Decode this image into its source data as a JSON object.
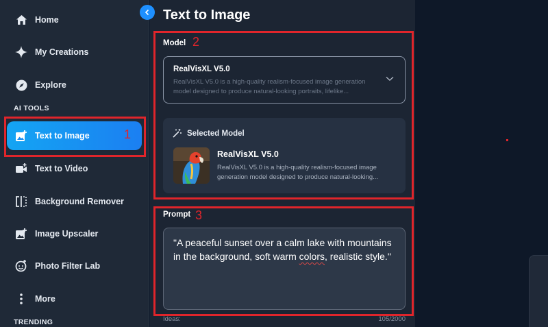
{
  "sidebar": {
    "items": [
      {
        "label": "Home",
        "icon": "home-icon"
      },
      {
        "label": "My Creations",
        "icon": "sparkle-icon"
      },
      {
        "label": "Explore",
        "icon": "compass-icon"
      }
    ],
    "section_ai_tools": "AI TOOLS",
    "tools": [
      {
        "label": "Text to Image",
        "icon": "image-plus-icon",
        "active": true
      },
      {
        "label": "Text to Video",
        "icon": "video-plus-icon"
      },
      {
        "label": "Background Remover",
        "icon": "bg-remove-icon"
      },
      {
        "label": "Image Upscaler",
        "icon": "image-upscale-icon"
      },
      {
        "label": "Photo Filter Lab",
        "icon": "face-filter-icon"
      },
      {
        "label": "More",
        "icon": "more-vertical-icon"
      }
    ],
    "section_trending": "TRENDING",
    "active_color": "#1b8ff2"
  },
  "main": {
    "title": "Text to Image",
    "model": {
      "label": "Model",
      "selected_name": "RealVisXL V5.0",
      "selected_desc": "RealVisXL V5.0 is a high-quality realism-focused image generation model designed to produce natural-looking portraits, lifelike..."
    },
    "selected_model": {
      "header": "Selected Model",
      "name": "RealVisXL V5.0",
      "desc": "RealVisXL V5.0 is a high-quality realism-focused image generation model designed to produce natural-looking..."
    },
    "prompt": {
      "label": "Prompt",
      "text_before": "\"A peaceful sunset over a calm lake with mountains in the background, soft warm ",
      "text_misspelled": "colors",
      "text_after": ", realistic style.\"",
      "ideas_label": "Ideas:",
      "counter": "105/2000"
    }
  },
  "annotations": {
    "numbers": [
      "1",
      "2",
      "3"
    ],
    "color": "#e0252b"
  }
}
